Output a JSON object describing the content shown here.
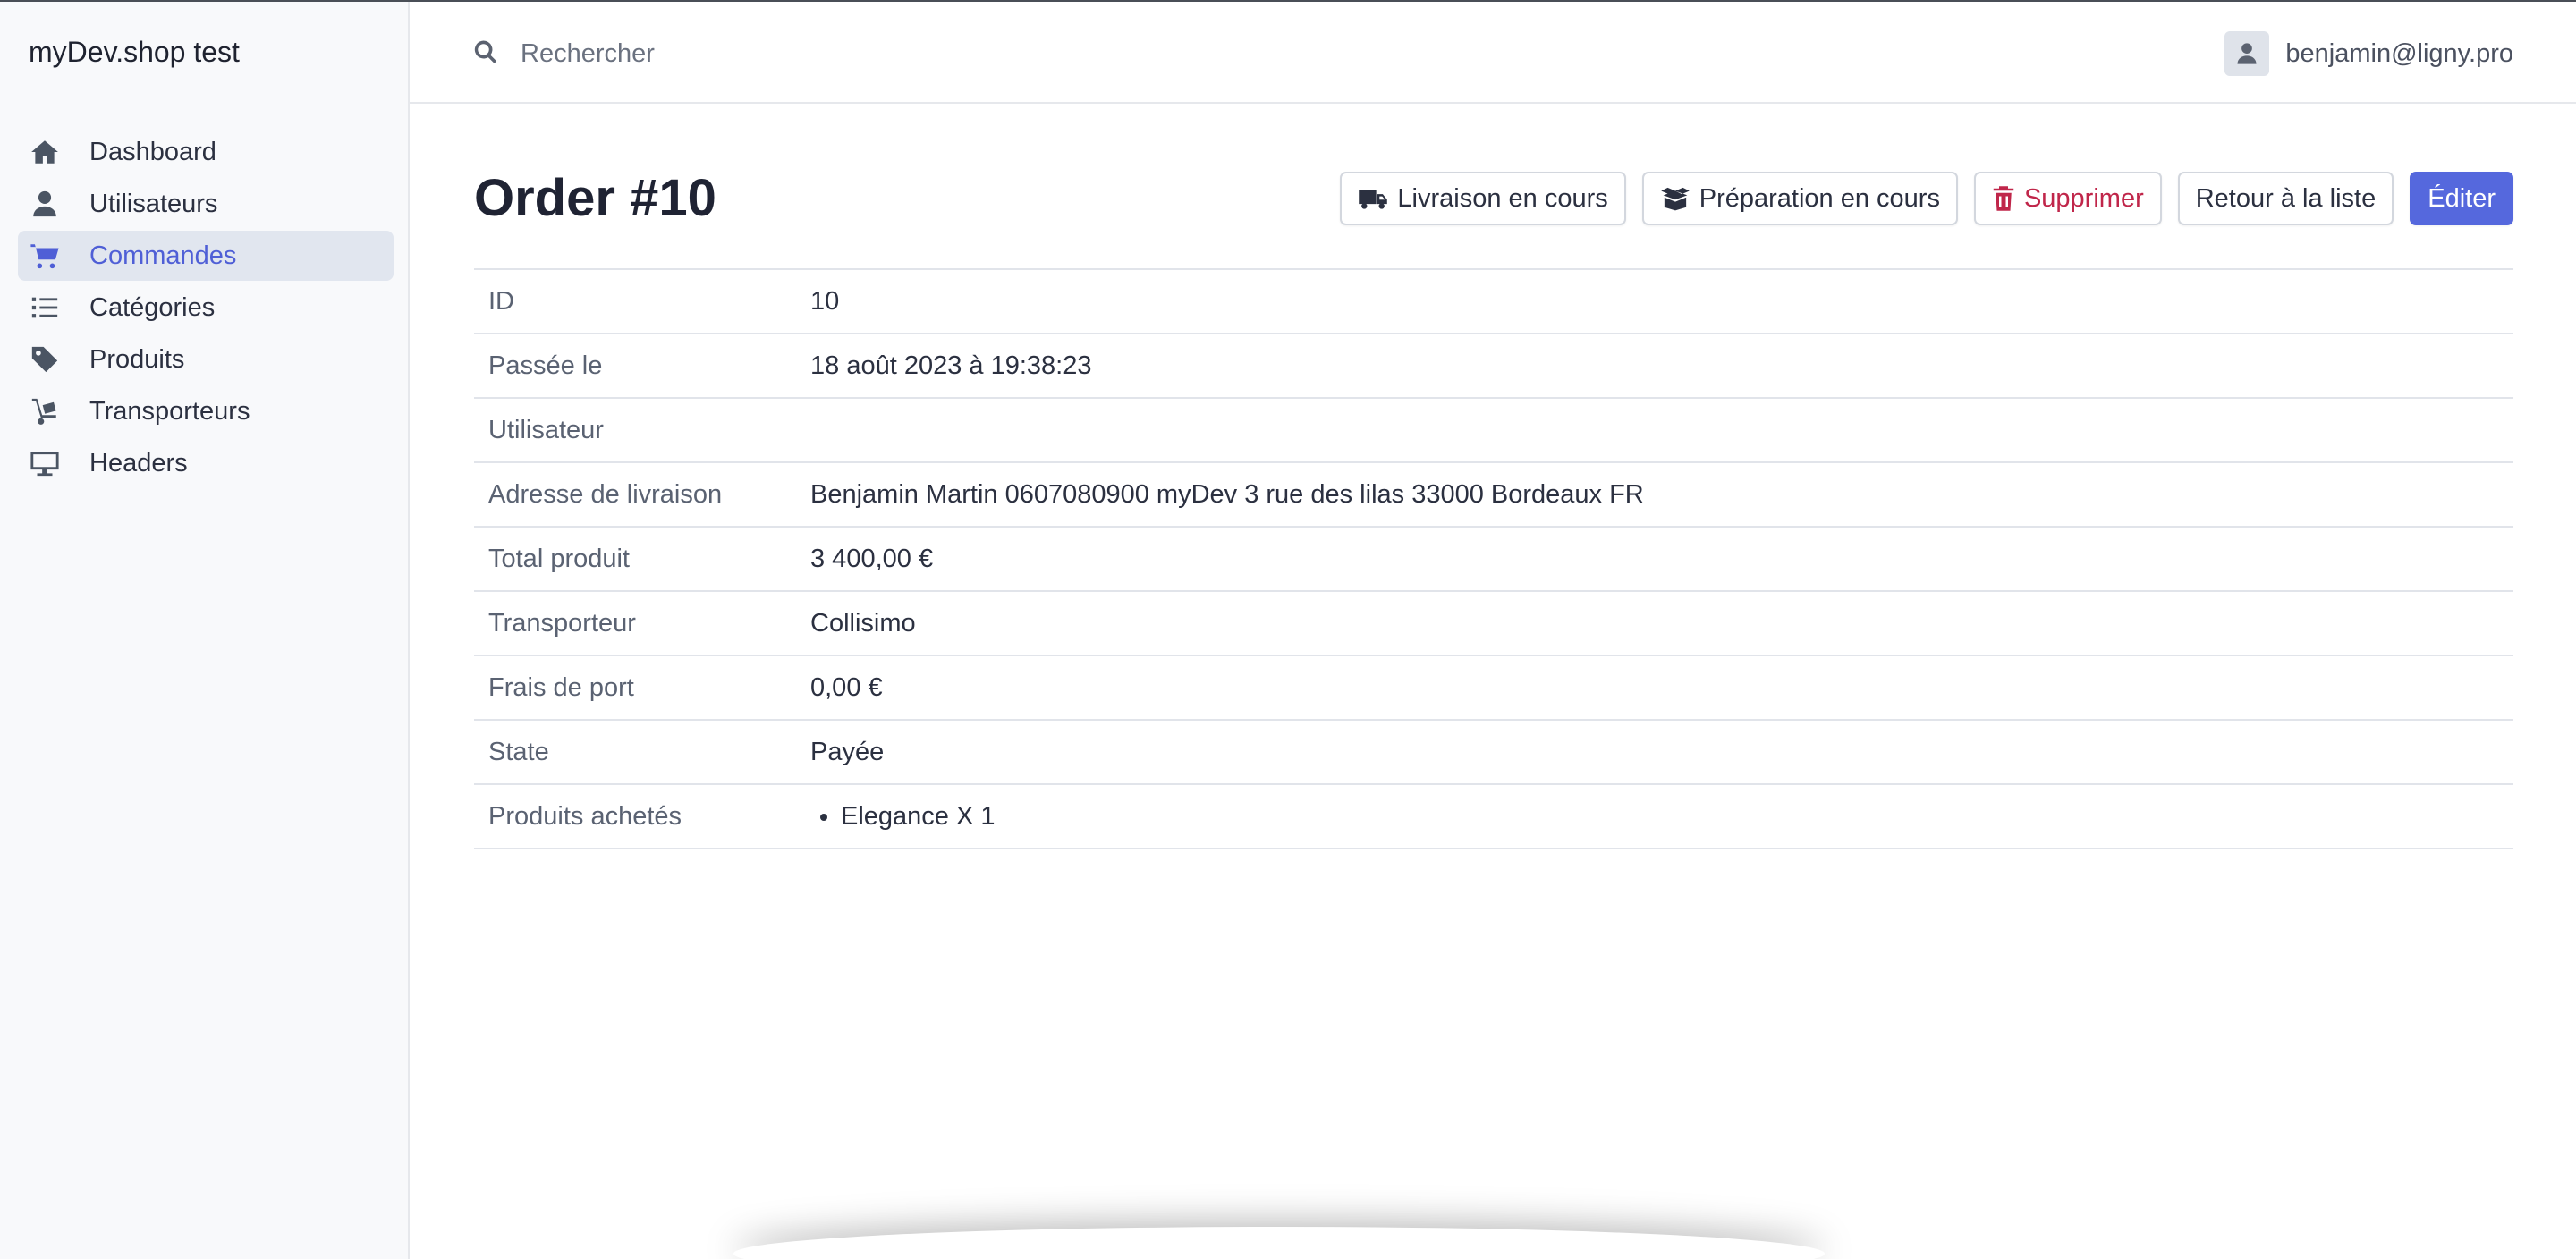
{
  "app": {
    "brand": "myDev.shop test"
  },
  "sidebar": {
    "items": [
      {
        "label": "Dashboard",
        "icon": "home-icon",
        "active": false
      },
      {
        "label": "Utilisateurs",
        "icon": "user-icon",
        "active": false
      },
      {
        "label": "Commandes",
        "icon": "cart-icon",
        "active": true
      },
      {
        "label": "Catégories",
        "icon": "list-icon",
        "active": false
      },
      {
        "label": "Produits",
        "icon": "tag-icon",
        "active": false
      },
      {
        "label": "Transporteurs",
        "icon": "dolly-icon",
        "active": false
      },
      {
        "label": "Headers",
        "icon": "desktop-icon",
        "active": false
      }
    ]
  },
  "header": {
    "search_placeholder": "Rechercher",
    "user_email": "benjamin@ligny.pro"
  },
  "page": {
    "title": "Order #10",
    "actions": {
      "shipping": "Livraison en cours",
      "preparation": "Préparation en cours",
      "delete": "Supprimer",
      "back": "Retour à la liste",
      "edit": "Éditer"
    }
  },
  "details": {
    "rows": [
      {
        "key": "ID",
        "value": "10"
      },
      {
        "key": "Passée le",
        "value": "18 août 2023 à 19:38:23"
      },
      {
        "key": "Utilisateur",
        "value": ""
      },
      {
        "key": "Adresse de livraison",
        "value": "Benjamin Martin 0607080900 myDev 3 rue des lilas 33000 Bordeaux FR"
      },
      {
        "key": "Total produit",
        "value": "3 400,00 €"
      },
      {
        "key": "Transporteur",
        "value": "Collisimo"
      },
      {
        "key": "Frais de port",
        "value": "0,00 €"
      },
      {
        "key": "State",
        "value": "Payée"
      }
    ],
    "products_label": "Produits achetés",
    "products": [
      "Elegance X 1"
    ]
  },
  "colors": {
    "accent": "#4f5fd6",
    "primary_button": "#5568dd",
    "danger": "#c0264a",
    "sidebar_bg": "#f8f9fb",
    "active_bg": "#e1e6ef"
  }
}
